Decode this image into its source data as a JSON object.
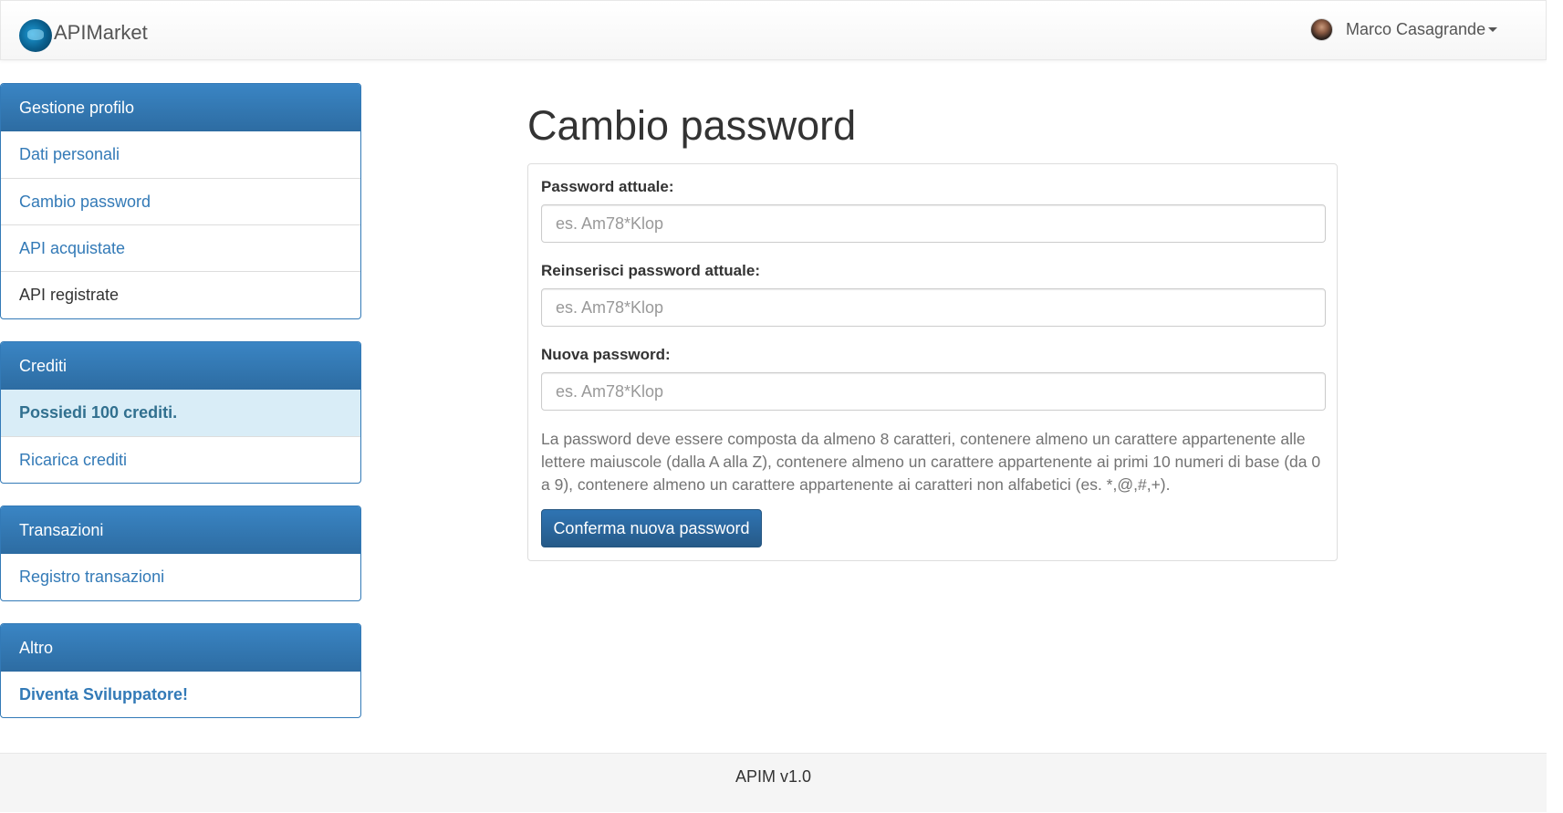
{
  "navbar": {
    "brand": "APIMarket",
    "user_name": "Marco Casagrande"
  },
  "sidebar": {
    "profile": {
      "heading": "Gestione profilo",
      "items": [
        "Dati personali",
        "Cambio password",
        "API acquistate",
        "API registrate"
      ]
    },
    "credits": {
      "heading": "Crediti",
      "balance_text": "Possiedi 100 crediti.",
      "recharge": "Ricarica crediti"
    },
    "transactions": {
      "heading": "Transazioni",
      "log": "Registro transazioni"
    },
    "other": {
      "heading": "Altro",
      "developer": "Diventa Sviluppatore!"
    }
  },
  "main": {
    "title": "Cambio password",
    "fields": [
      {
        "label": "Password attuale:",
        "placeholder": "es. Am78*Klop"
      },
      {
        "label": "Reinserisci password attuale:",
        "placeholder": "es. Am78*Klop"
      },
      {
        "label": "Nuova password:",
        "placeholder": "es. Am78*Klop"
      }
    ],
    "help_text": "La password deve essere composta da almeno 8 caratteri, contenere almeno un carattere appartenente alle lettere maiuscole (dalla A alla Z), contenere almeno un carattere appartenente ai primi 10 numeri di base (da 0 a 9), contenere almeno un carattere appartenente ai caratteri non alfabetici (es. *,@,#,+).",
    "submit_label": "Conferma nuova password"
  },
  "footer": {
    "text": "APIM v1.0"
  },
  "colors": {
    "primary": "#337ab7",
    "panel_heading": "#2d6ca2",
    "info_background": "#d9edf7"
  },
  "icons": {
    "brand": "apimarket-logo-icon",
    "user": "user-avatar",
    "dropdown": "caret-down-icon"
  }
}
